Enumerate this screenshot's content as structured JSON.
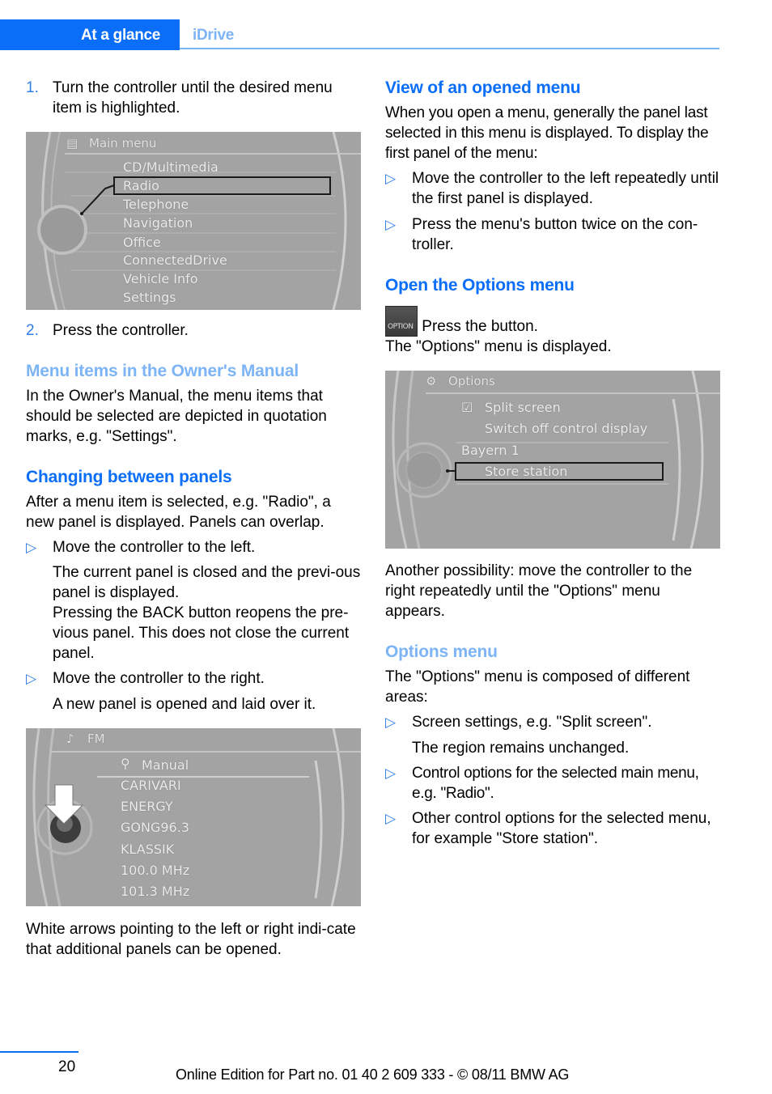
{
  "header": {
    "section_active": "At a glance",
    "section_current": "iDrive"
  },
  "colors": {
    "accent": "#0a6ef9",
    "accent_light": "#7db4f6",
    "number_blue": "#2f7fe8",
    "screen_gray": "#9d9d9d"
  },
  "left": {
    "step1": {
      "num": "1.",
      "text": "Turn the controller until the desired menu item is highlighted."
    },
    "screen_main_menu": {
      "title_icon": "menu-icon",
      "title": "Main menu",
      "items": [
        "CD/Multimedia",
        "Radio",
        "Telephone",
        "Navigation",
        "Office",
        "ConnectedDrive",
        "Vehicle Info",
        "Settings"
      ],
      "highlighted": "Radio"
    },
    "step2": {
      "num": "2.",
      "text": "Press the controller."
    },
    "menu_items_heading": "Menu items in the Owner's Manual",
    "menu_items_text": "In the Owner's Manual, the menu items that should be selected are depicted in quotation marks, e.g. \"Settings\".",
    "changing_heading": "Changing between panels",
    "changing_text": "After a menu item is selected, e.g. \"Radio\", a new panel is displayed. Panels can overlap.",
    "bullets": [
      {
        "marker": "▷",
        "text": "Move the controller to the left.",
        "sub": [
          "The current panel is closed and the previ-ous panel is displayed.",
          "Pressing the BACK button reopens the pre-vious panel. This does not close the current panel."
        ]
      },
      {
        "marker": "▷",
        "text": "Move the controller to the right.",
        "sub": [
          "A new panel is opened and laid over it."
        ]
      }
    ],
    "screen_fm": {
      "title_icon": "radio-icon",
      "title": "FM",
      "search_item": "Manual",
      "stations": [
        "CARIVARI",
        "ENERGY",
        "GONG96.3",
        "KLASSIK",
        "100.0 MHz",
        "101.3 MHz"
      ]
    },
    "arrows_text": "White arrows pointing to the left or right indi-cate that additional panels can be opened."
  },
  "right": {
    "view_heading": "View of an opened menu",
    "view_text": "When you open a menu, generally the panel last selected in this menu is displayed. To display the first panel of the menu:",
    "view_bullets": [
      {
        "marker": "▷",
        "text": "Move the controller to the left repeatedly until the first panel is displayed."
      },
      {
        "marker": "▷",
        "text": "Press the menu's button twice on the con-troller."
      }
    ],
    "open_options_heading": "Open the Options menu",
    "option_button_label": "OPTION",
    "press_text": " Press the button.",
    "displayed_text": "The \"Options\" menu is displayed.",
    "screen_options": {
      "title_icon": "options-icon",
      "title": "Options",
      "items": [
        "Split screen",
        "Switch off control display"
      ],
      "station": "Bayern 1",
      "highlighted": "Store station"
    },
    "another_text": "Another possibility: move the controller to the right repeatedly until the \"Options\" menu appears.",
    "options_menu_heading": "Options menu",
    "options_menu_text": "The \"Options\" menu is composed of different areas:",
    "options_bullets": [
      {
        "marker": "▷",
        "text": "Screen settings, e.g. \"Split screen\".",
        "sub": "The region remains unchanged."
      },
      {
        "marker": "▷",
        "text": "Control options for the selected main menu, e.g. \"Radio\".",
        "sub": null
      },
      {
        "marker": "▷",
        "text": "Other control options for the selected menu, for example \"Store station\".",
        "sub": null
      }
    ]
  },
  "footer": {
    "page_number": "20",
    "edition_text": "Online Edition for Part no. 01 40 2 609 333 - © 08/11 BMW AG"
  }
}
